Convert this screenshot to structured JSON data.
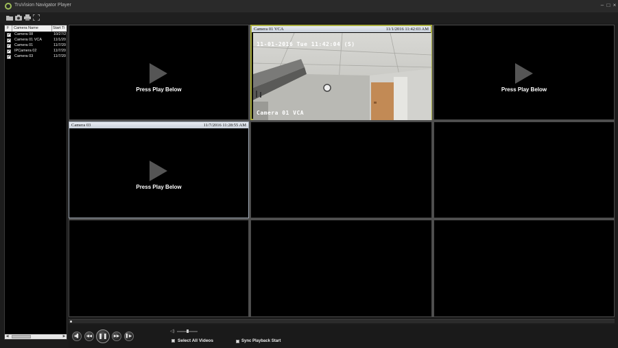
{
  "window": {
    "title": "TruVision Navigator Player",
    "accent_color": "#a9ad3c"
  },
  "toolbar": {
    "icons": [
      "open-folder-icon",
      "camera-icon",
      "print-icon",
      "fullscreen-icon"
    ]
  },
  "sidebar": {
    "columns": {
      "flag": "F",
      "name": "Camera Name",
      "start": "Start Ti"
    },
    "cameras": [
      {
        "name": "Camera 08",
        "start": "10/27/2",
        "checked": true
      },
      {
        "name": "Camera 01 VCA",
        "start": "11/1/20",
        "checked": true
      },
      {
        "name": "Camera 01",
        "start": "11/7/20",
        "checked": true
      },
      {
        "name": "IPCamera 02",
        "start": "11/7/20",
        "checked": true
      },
      {
        "name": "Camera 03",
        "start": "11/7/20",
        "checked": true
      }
    ]
  },
  "tiles": {
    "t1": {
      "prompt": "Press Play Below"
    },
    "t2": {
      "camera": "Camera 01 VCA",
      "time": "11/1/2016 11:42:03 AM",
      "osd_date": "11-01-2016 Tue 11:42:04 (S)",
      "osd_name": "Camera 01 VCA"
    },
    "t3": {
      "prompt": "Press Play Below"
    },
    "t4": {
      "camera": "Camera 03",
      "time": "11/7/2016 11:28:55 AM",
      "prompt": "Press Play Below"
    }
  },
  "controls": {
    "buttons": {
      "step_back": "◀▌",
      "rewind": "◀◀",
      "pause": "❚❚",
      "forward": "▶▶",
      "step_forward": "▌▶"
    },
    "volume_icon": "◁)",
    "select_all": "Select All Videos",
    "sync_start": "Sync Playback Start"
  }
}
